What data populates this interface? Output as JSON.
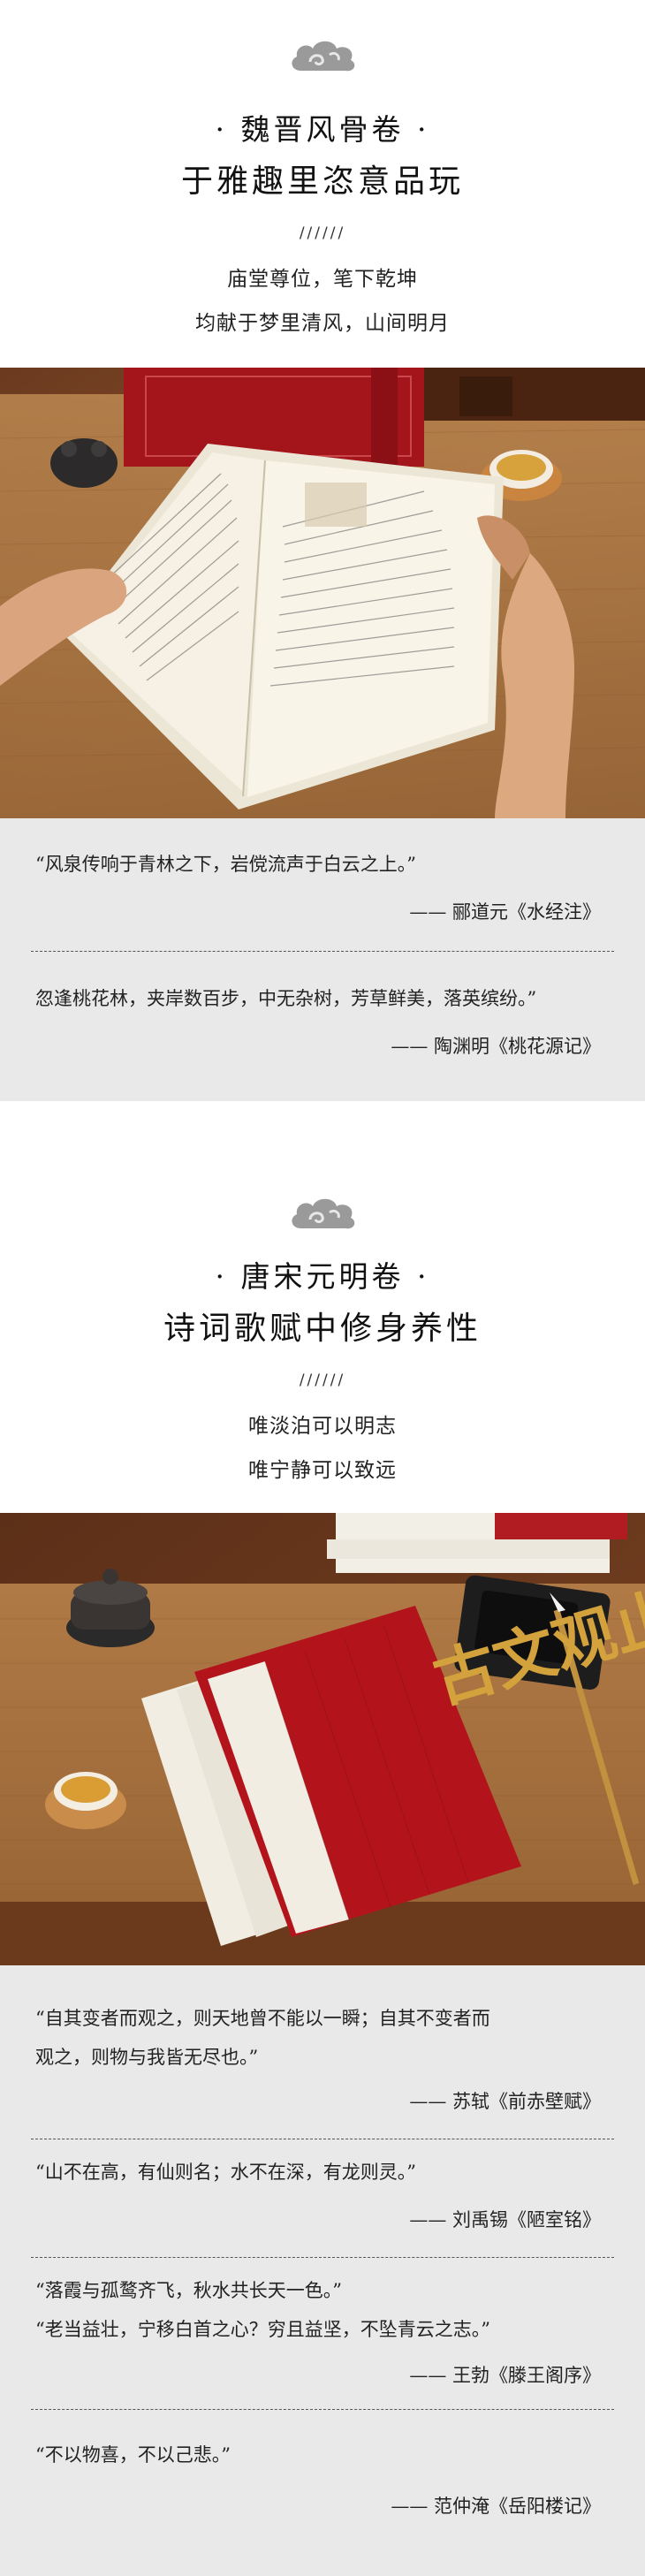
{
  "section1": {
    "title_line1": "· 魏晋风骨卷 ·",
    "title_line2": "于雅趣里恣意品玩",
    "slashes": "//////",
    "sub_line1": "庙堂尊位，笔下乾坤",
    "sub_line2": "均献于梦里清风，山间明月",
    "quotes": [
      {
        "text": "“风泉传响于青林之下，岩傥流声于白云之上。”",
        "author": "—— 郦道元《水经注》"
      },
      {
        "text": "忽逢桃花林，夹岸数百步，中无杂树，芳草鲜美，落英缤纷。”",
        "author": "—— 陶渊明《桃花源记》"
      }
    ]
  },
  "section2": {
    "title_line1": "· 唐宋元明卷 ·",
    "title_line2": "诗词歌赋中修身养性",
    "slashes": "//////",
    "sub_line1": "唯淡泊可以明志",
    "sub_line2": "唯宁静可以致远",
    "book_cover_title": "古文观止",
    "quotes": [
      {
        "text_line1": "“自其变者而观之，则天地曾不能以一瞬；自其不变者而",
        "text_line2": "观之，则物与我皆无尽也。”",
        "author": "—— 苏轼《前赤壁赋》"
      },
      {
        "text_line1": "“山不在高，有仙则名；水不在深，有龙则灵。”",
        "author": "—— 刘禹锡《陋室铭》"
      },
      {
        "text_line1": "“落霞与孤鹜齐飞，秋水共长天一色。”",
        "text_line2": "“老当益壮，宁移白首之心？穷且益坚，不坠青云之志。”",
        "author": "—— 王勃《滕王阁序》"
      },
      {
        "text_line1": "“不以物喜，不以己悲。”",
        "author": "—— 范仲淹《岳阳楼记》"
      }
    ]
  }
}
